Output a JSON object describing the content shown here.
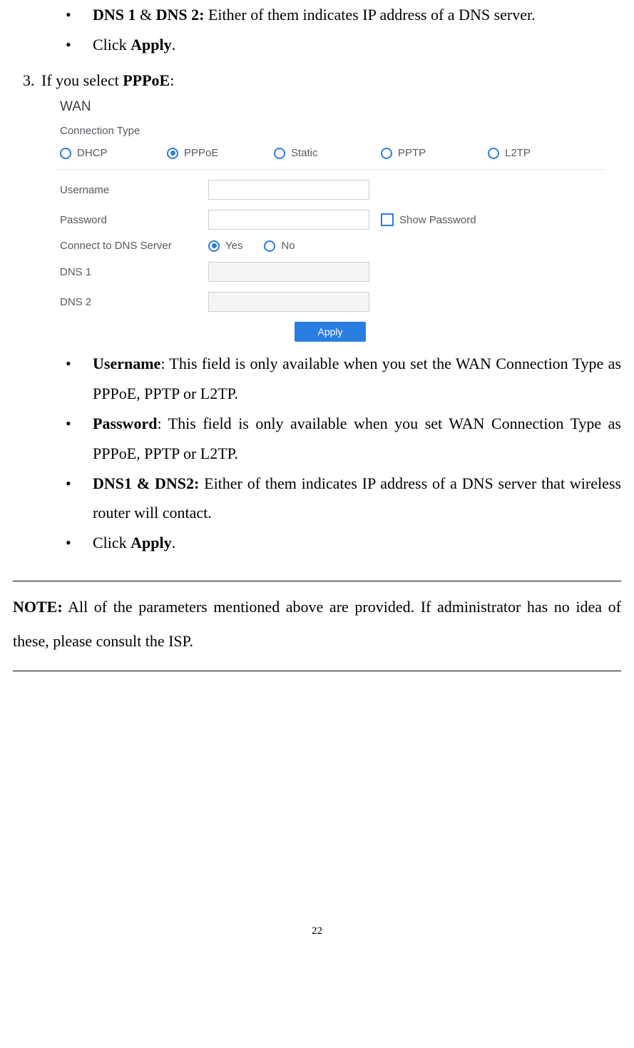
{
  "intro": {
    "bullet_dns_bold_a": "DNS 1",
    "bullet_dns_amp": " & ",
    "bullet_dns_bold_b": "DNS 2:",
    "bullet_dns_text": " Either of them indicates IP address of a DNS server.",
    "bullet_apply_pre": "Click ",
    "bullet_apply_bold": "Apply",
    "bullet_apply_post": "."
  },
  "step3": {
    "num": "3.",
    "pre": "If you select ",
    "bold": "PPPoE",
    "post": ":"
  },
  "wan": {
    "title": "WAN",
    "conn_type": "Connection Type",
    "opts": {
      "dhcp": "DHCP",
      "pppoe": "PPPoE",
      "static": "Static",
      "pptp": "PPTP",
      "l2tp": "L2TP"
    },
    "labels": {
      "username": "Username",
      "password": "Password",
      "connect_dns": "Connect to DNS Server",
      "dns1": "DNS 1",
      "dns2": "DNS 2"
    },
    "show_password": "Show Password",
    "yes": "Yes",
    "no": "No",
    "apply": "Apply"
  },
  "desc": {
    "username_bold": "Username",
    "username_text": ": This field is only available when you set the WAN Connection Type as PPPoE, PPTP or L2TP.",
    "password_bold": "Password",
    "password_text": ": This field is only available when you set WAN Connection Type as PPPoE, PPTP or L2TP.",
    "dns_bold": "DNS1 & DNS2:",
    "dns_text": " Either of them indicates IP address of a DNS server that wireless router will contact.",
    "apply_pre": "Click ",
    "apply_bold": "Apply",
    "apply_post": "."
  },
  "note": {
    "bold": "NOTE:",
    "text": " All of the parameters mentioned above are provided. If administrator has no idea of these, please consult the ISP."
  },
  "page": "22"
}
